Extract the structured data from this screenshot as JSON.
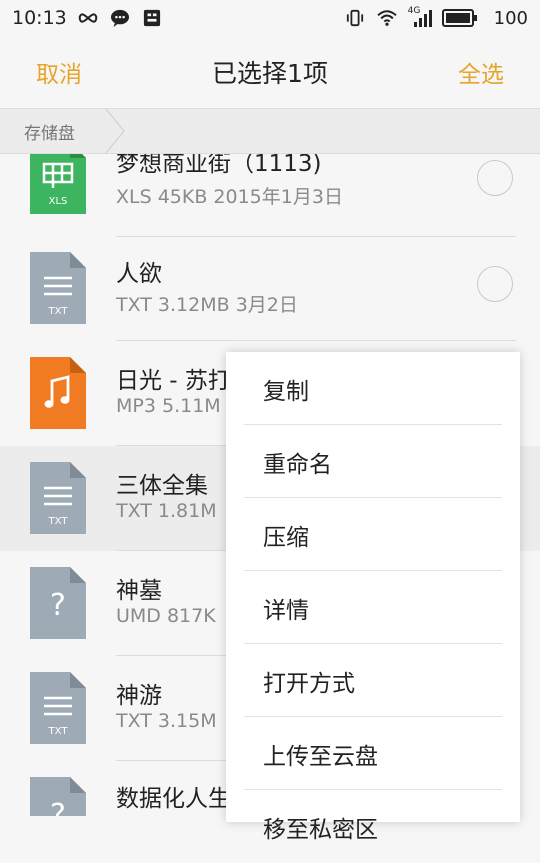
{
  "status_bar": {
    "time": "10:13",
    "battery": "100",
    "network": "4G"
  },
  "action_bar": {
    "cancel": "取消",
    "title": "已选择1项",
    "select_all": "全选"
  },
  "breadcrumb": {
    "root": "存储盘"
  },
  "files": [
    {
      "name": "梦想商业街（1113)",
      "meta": "XLS  45KB  2015年1月3日",
      "type": "XLS",
      "icon": "spreadsheet-icon",
      "color": "#3db45f",
      "selected": false
    },
    {
      "name": "人欲",
      "meta": "TXT  3.12MB  3月2日",
      "type": "TXT",
      "icon": "text-file-icon",
      "color": "#9eaab6",
      "selected": false
    },
    {
      "name": "日光 - 苏打",
      "meta": "MP3  5.11M",
      "type": "MP3",
      "icon": "music-file-icon",
      "color": "#f07b22",
      "selected": false
    },
    {
      "name": "三体全集",
      "meta": "TXT  1.81M",
      "type": "TXT",
      "icon": "text-file-icon",
      "color": "#9eaab6",
      "selected": true
    },
    {
      "name": "神墓",
      "meta": "UMD  817K",
      "type": "UMD",
      "icon": "unknown-file-icon",
      "color": "#9eaab6",
      "selected": false
    },
    {
      "name": "神游",
      "meta": "TXT  3.15M",
      "type": "TXT",
      "icon": "text-file-icon",
      "color": "#9eaab6",
      "selected": false
    },
    {
      "name": "数据化人生",
      "meta": "",
      "type": "",
      "icon": "unknown-file-icon",
      "color": "#9eaab6",
      "selected": false
    }
  ],
  "menu": {
    "items": [
      "复制",
      "重命名",
      "压缩",
      "详情",
      "打开方式",
      "上传至云盘",
      "移至私密区"
    ]
  },
  "colors": {
    "accent": "#e6a42b",
    "background": "#f6f6f6"
  }
}
